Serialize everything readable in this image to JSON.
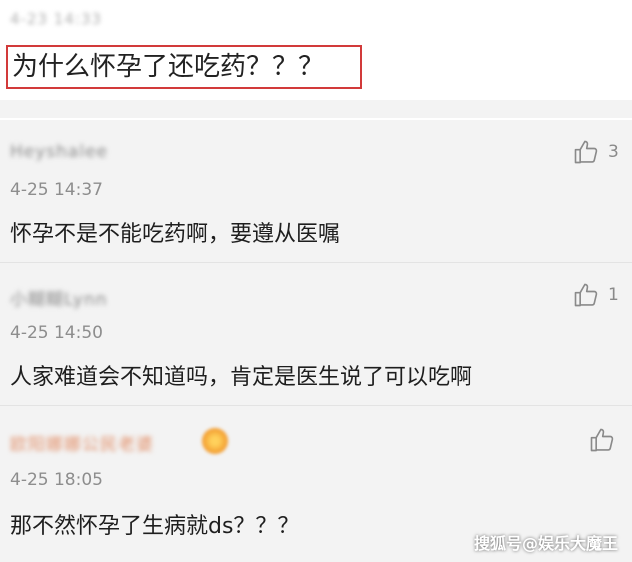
{
  "post": {
    "timestamp": "4-23 14:33",
    "question": "为什么怀孕了还吃药？？？"
  },
  "comments": [
    {
      "username": "Heyshalee",
      "time": "4-25 14:37",
      "text": "怀孕不是不能吃药啊，要遵从医嘱",
      "likes": "3"
    },
    {
      "username": "小糊糊Lynn",
      "time": "4-25 14:50",
      "text": "人家难道会不知道吗，肯定是医生说了可以吃啊",
      "likes": "1"
    },
    {
      "username": "欧阳娜娜公民老婆",
      "time": "4-25 18:05",
      "text": "那不然怀孕了生病就ds？？？",
      "likes": ""
    }
  ],
  "watermark": "搜狐号@娱乐大魔王",
  "colors": {
    "highlight_border": "#d23a3a",
    "background": "#f3f3f3"
  }
}
